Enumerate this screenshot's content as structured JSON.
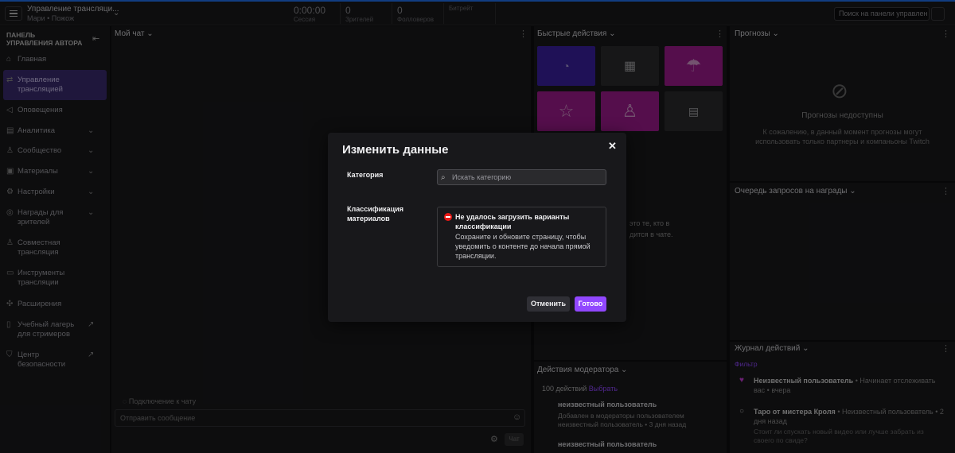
{
  "topbar": {
    "title": "Управление трансляци...",
    "subtitle": "Мари • Пожож",
    "stats": [
      {
        "value": "0:00:00",
        "label": "Сессия"
      },
      {
        "value": "0",
        "label": "Зрителей"
      },
      {
        "value": "0",
        "label": "Фолловеров"
      },
      {
        "value": "",
        "label": "Битрейт"
      }
    ],
    "search_placeholder": "Поиск на панели управлен"
  },
  "sidebar": {
    "header": "ПАНЕЛЬ УПРАВЛЕНИЯ АВТОРА",
    "items": [
      {
        "label": "Главная",
        "icon": "home-icon"
      },
      {
        "label": "Управление трансляцией",
        "icon": "stream-icon"
      },
      {
        "label": "Оповещения",
        "icon": "megaphone-icon"
      },
      {
        "label": "Аналитика",
        "icon": "chart-icon"
      },
      {
        "label": "Сообщество",
        "icon": "community-icon"
      },
      {
        "label": "Материалы",
        "icon": "content-icon"
      },
      {
        "label": "Настройки",
        "icon": "gear-icon"
      },
      {
        "label": "Награды для зрителей",
        "icon": "reward-icon"
      },
      {
        "label": "Совместная трансляция",
        "icon": "collab-icon"
      },
      {
        "label": "Инструменты трансляции",
        "icon": "camera-icon"
      },
      {
        "label": "Расширения",
        "icon": "puzzle-icon"
      },
      {
        "label": "Учебный лагерь для стримеров",
        "icon": "book-icon"
      },
      {
        "label": "Центр безопасности",
        "icon": "shield-icon"
      }
    ]
  },
  "chat": {
    "title": "Мой чат",
    "connecting": "Подключение к чату",
    "input_placeholder": "Отправить сообщение",
    "send_label": "Чат"
  },
  "quick_actions": {
    "title": "Быстрые действия"
  },
  "predictions": {
    "title": "Прогнозы",
    "unavailable_title": "Прогнозы недоступны",
    "unavailable_text": "К сожалению, в данный момент прогнозы могут использовать только партнеры и компаньоны Twitch"
  },
  "reward_queue": {
    "title": "Очередь запросов на награды"
  },
  "mod_actions": {
    "title": "Действия модератора",
    "count": "100 действий",
    "select": "Выбрать",
    "entries": [
      {
        "user": "неизвестный пользователь",
        "text": "Добавлен в модераторы пользователем неизвестный пользователь • 3 дня назад"
      },
      {
        "user": "неизвестный пользователь",
        "text": ""
      }
    ]
  },
  "activity": {
    "title": "Журнал действий",
    "filter": "Фильтр",
    "entries": [
      {
        "user": "Неизвестный пользователь",
        "text": "• Начинает отслеживать вас • вчера"
      },
      {
        "user": "Таро от мистера Кроля",
        "text": "• Неизвестный пользователь • 2 дня назад",
        "sub": "Стоит ли спускать новый видео или лучше забрать из своего по свиде?"
      }
    ]
  },
  "middle_hidden": {
    "line1": "это те, кто в",
    "line2": "дится в чате."
  },
  "modal": {
    "title": "Изменить данные",
    "category_label": "Категория",
    "category_placeholder": "Искать категорию",
    "classification_label": "Классификация материалов",
    "error_title": "Не удалось загрузить варианты классификации",
    "error_text": "Сохраните и обновите страницу, чтобы уведомить о контенте до начала прямой трансляции.",
    "cancel_label": "Отменить",
    "done_label": "Готово"
  },
  "colors": {
    "accent": "#9147ff",
    "error": "#e91916",
    "tile_purple": "#3a1f9e",
    "tile_magenta": "#9b1a8a",
    "tile_dark": "#2a2a2d"
  }
}
